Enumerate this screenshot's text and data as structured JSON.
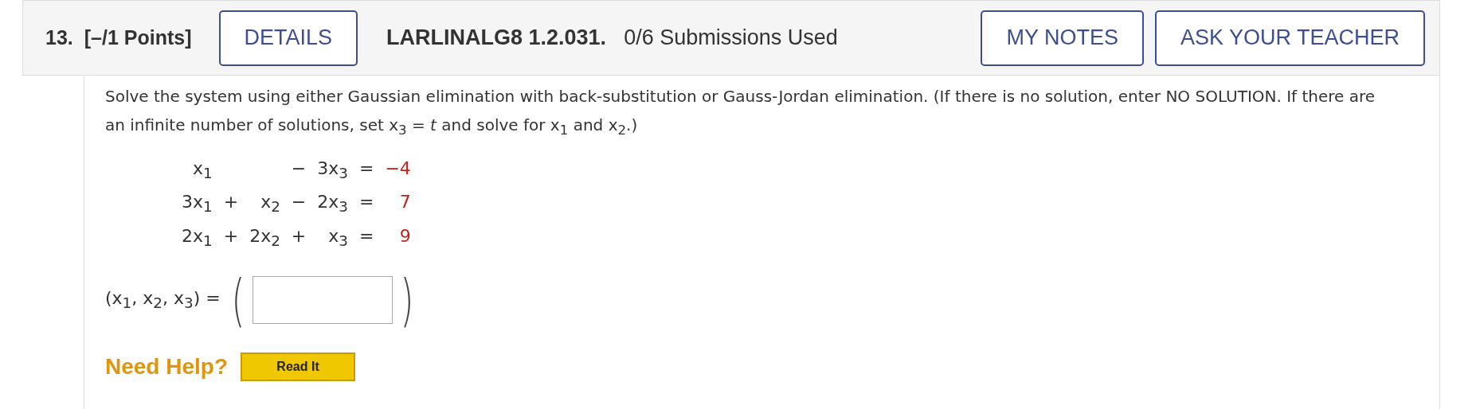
{
  "question": {
    "number": "13.",
    "points": "[–/1 Points]",
    "details_button": "DETAILS",
    "problem_id": "LARLINALG8 1.2.031.",
    "submissions": "0/6 Submissions Used",
    "my_notes_button": "MY NOTES",
    "ask_teacher_button": "ASK YOUR TEACHER"
  },
  "instructions": "Solve the system using either Gaussian elimination with back-substitution or Gauss-Jordan elimination. (If there is no solution, enter NO SOLUTION. If there are an infinite number of solutions, set x$_{3}$ = *t* and solve for x$_{1}$ and x$_{2}$.)",
  "equations": [
    {
      "x1": "x$_{1}$",
      "op2": "−",
      "x3": "3x$_{3}$",
      "equals": "=",
      "rhs": "−4"
    },
    {
      "x1": "3x$_{1}$",
      "op1": "+",
      "x2": "x$_{2}$",
      "op2": "−",
      "x3": "2x$_{3}$",
      "equals": "=",
      "rhs": "7"
    },
    {
      "x1": "2x$_{1}$",
      "op1": "+",
      "x2": "2x$_{2}$",
      "op2": "+",
      "x3": "x$_{3}$",
      "equals": "=",
      "rhs": "9"
    }
  ],
  "answer": {
    "label": "(x$_{1}$, x$_{2}$, x$_{3}$) =",
    "open_paren": "(",
    "close_paren": ")"
  },
  "help": {
    "label": "Need Help?",
    "read_it_button": "Read It"
  }
}
